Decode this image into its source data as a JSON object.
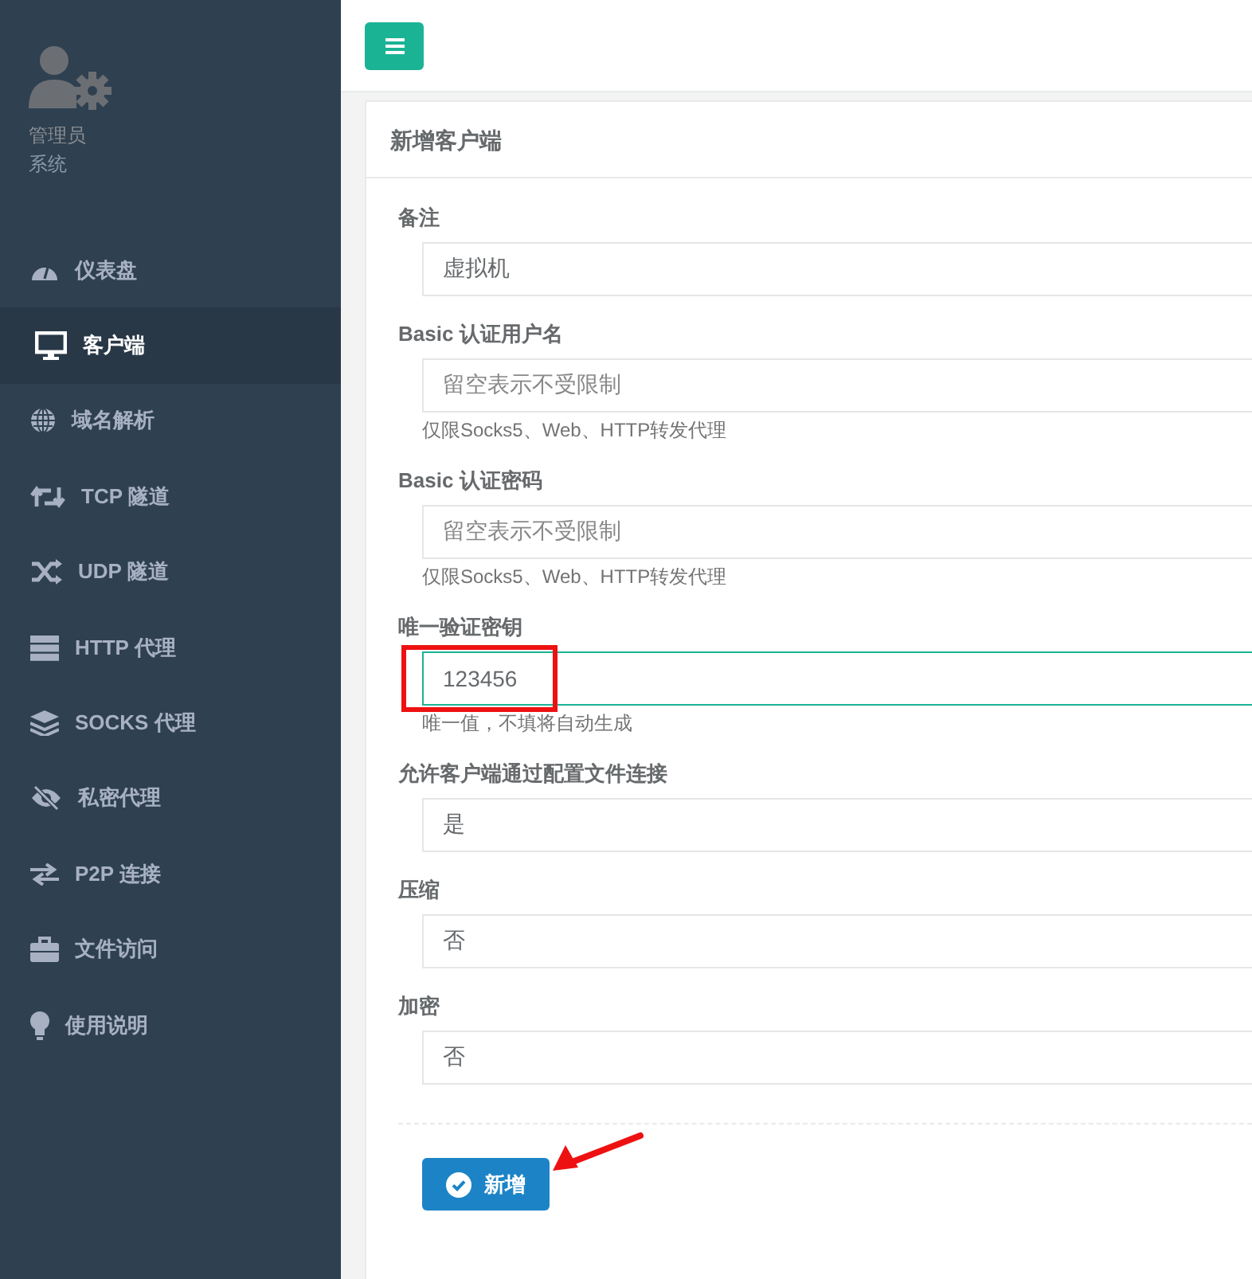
{
  "sidebar": {
    "profile": {
      "name": "管理员",
      "role": "系统"
    },
    "items": [
      {
        "label": "仪表盘",
        "selected": false
      },
      {
        "label": "客户端",
        "selected": true
      },
      {
        "label": "域名解析",
        "selected": false
      },
      {
        "label": "TCP 隧道",
        "selected": false
      },
      {
        "label": "UDP 隧道",
        "selected": false
      },
      {
        "label": "HTTP 代理",
        "selected": false
      },
      {
        "label": "SOCKS 代理",
        "selected": false
      },
      {
        "label": "私密代理",
        "selected": false
      },
      {
        "label": "P2P 连接",
        "selected": false
      },
      {
        "label": "文件访问",
        "selected": false
      },
      {
        "label": "使用说明",
        "selected": false
      }
    ]
  },
  "panel": {
    "title": "新增客户端",
    "fields": [
      {
        "kind": "text",
        "label": "备注",
        "value": "虚拟机"
      },
      {
        "kind": "text",
        "label": "Basic 认证用户名",
        "placeholder": "留空表示不受限制",
        "help": "仅限Socks5、Web、HTTP转发代理"
      },
      {
        "kind": "text",
        "label": "Basic 认证密码",
        "placeholder": "留空表示不受限制",
        "help": "仅限Socks5、Web、HTTP转发代理"
      },
      {
        "kind": "text",
        "label": "唯一验证密钥",
        "value": "123456",
        "help": "唯一值，不填将自动生成",
        "highlighted": true,
        "focused": true
      },
      {
        "kind": "select",
        "label": "允许客户端通过配置文件连接",
        "value": "是"
      },
      {
        "kind": "select",
        "label": "压缩",
        "value": "否"
      },
      {
        "kind": "select",
        "label": "加密",
        "value": "否"
      }
    ],
    "submit": {
      "label": "新增",
      "arrow": true
    }
  }
}
